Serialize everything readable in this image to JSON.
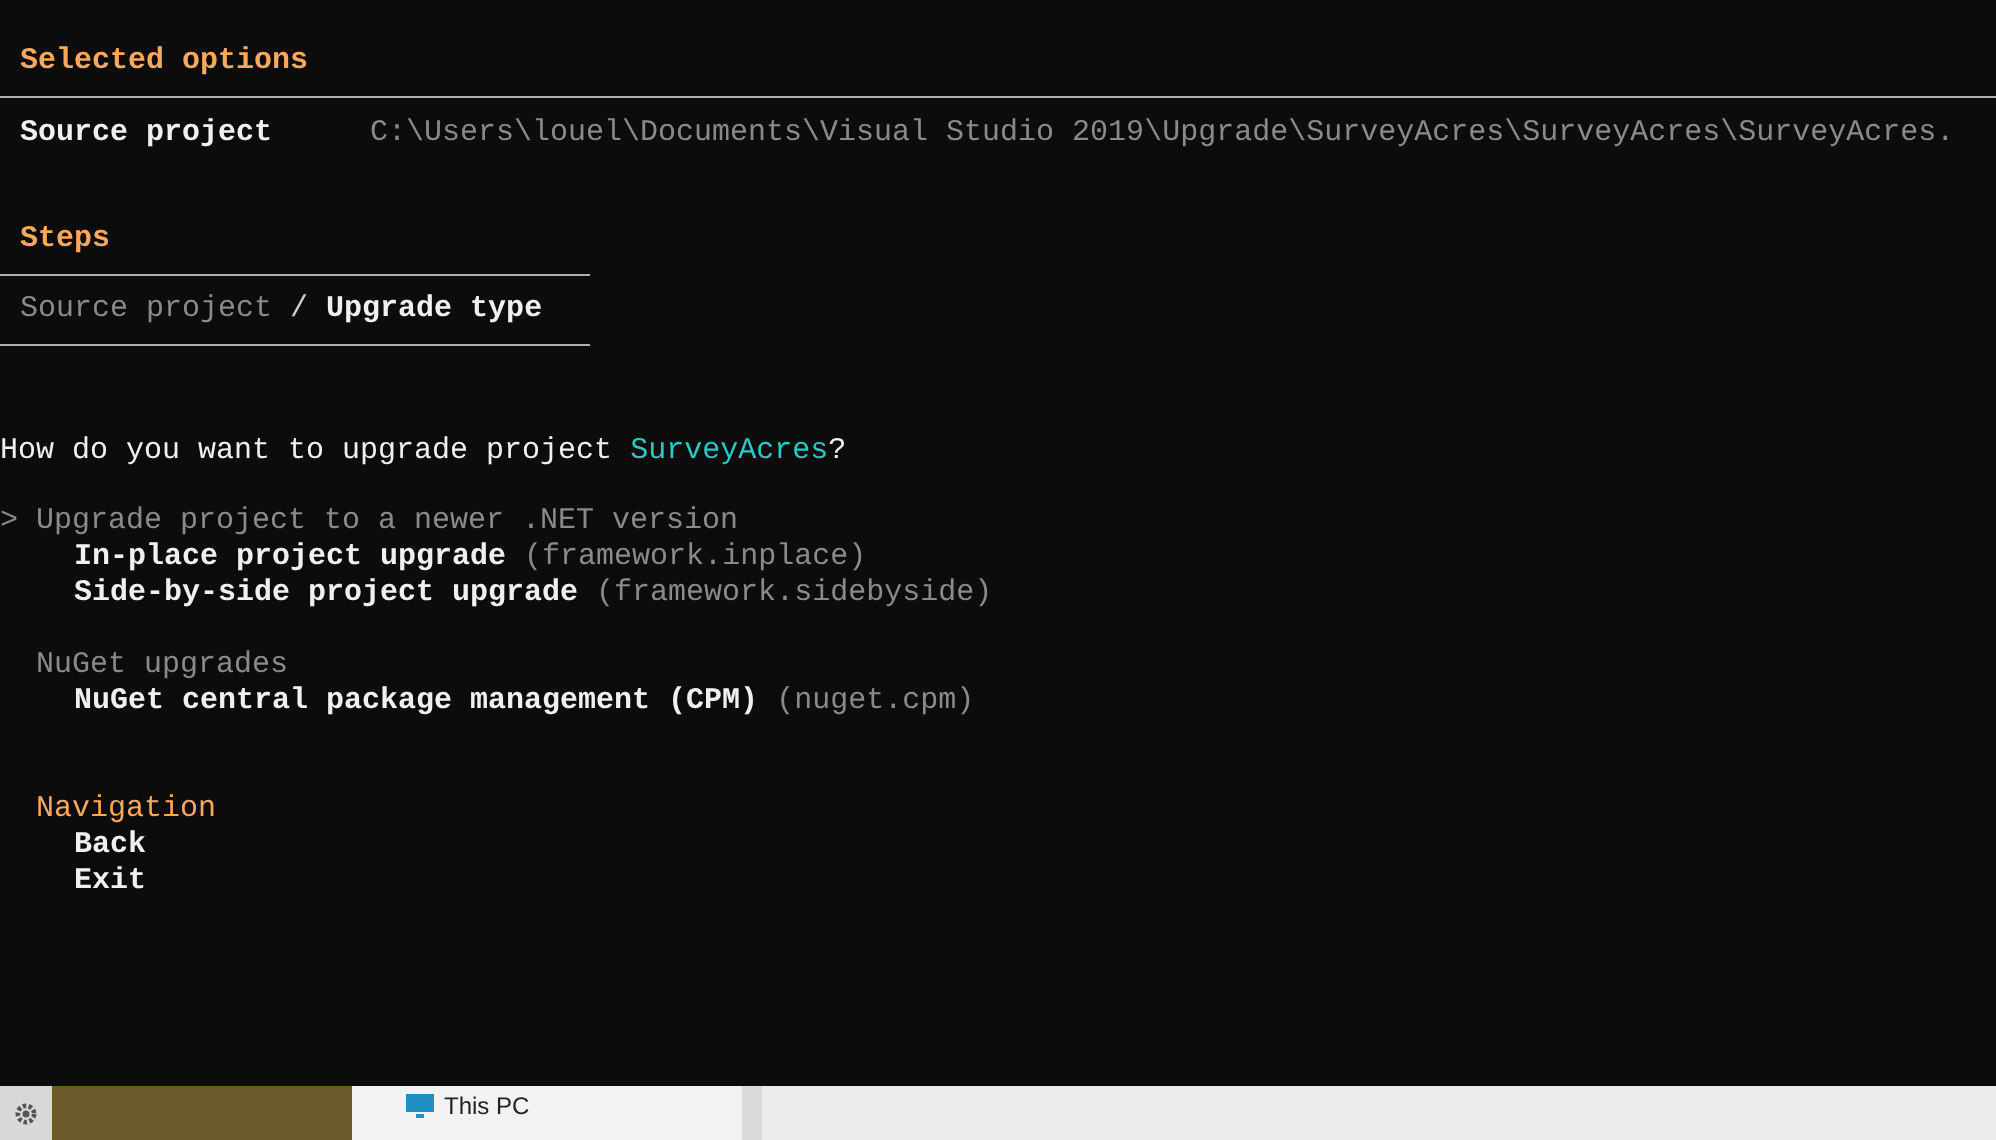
{
  "selected_options": {
    "title": "Selected options",
    "rows": [
      {
        "label": "Source project",
        "value": "C:\\Users\\louel\\Documents\\Visual Studio 2019\\Upgrade\\SurveyAcres\\SurveyAcres\\SurveyAcres."
      }
    ]
  },
  "steps": {
    "title": "Steps",
    "separator": "/",
    "crumbs": [
      {
        "label": "Source project",
        "current": false
      },
      {
        "label": "Upgrade type",
        "current": true
      }
    ]
  },
  "question": {
    "text": "How do you want to upgrade project ",
    "project": "SurveyAcres",
    "end": "?"
  },
  "menu": {
    "cursor": ">",
    "groups": [
      {
        "title": "Upgrade project to a newer .NET version",
        "kind": "category",
        "selected": true,
        "items": [
          {
            "label": "In-place project upgrade",
            "id": "(framework.inplace)"
          },
          {
            "label": "Side-by-side project upgrade",
            "id": "(framework.sidebyside)"
          }
        ]
      },
      {
        "title": "NuGet upgrades",
        "kind": "category",
        "selected": false,
        "items": [
          {
            "label": "NuGet central package management (CPM)",
            "id": "(nuget.cpm)"
          }
        ]
      },
      {
        "title": "Navigation",
        "kind": "navigation",
        "selected": false,
        "items": [
          {
            "label": "Back"
          },
          {
            "label": "Exit"
          }
        ]
      }
    ]
  },
  "desktop": {
    "items": [
      {
        "label": "This PC"
      }
    ]
  }
}
